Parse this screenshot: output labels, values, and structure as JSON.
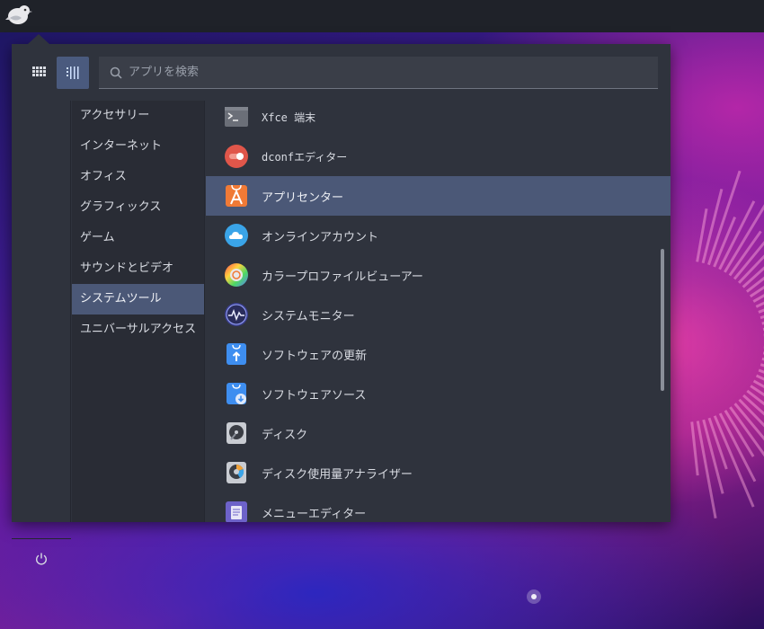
{
  "search": {
    "placeholder": "アプリを検索"
  },
  "view_toggle": {
    "grid_icon": "grid-icon",
    "list_icon": "list-icon"
  },
  "categories": [
    {
      "label": "アクセサリー"
    },
    {
      "label": "インターネット"
    },
    {
      "label": "オフィス"
    },
    {
      "label": "グラフィックス"
    },
    {
      "label": "ゲーム"
    },
    {
      "label": "サウンドとビデオ"
    },
    {
      "label": "システムツール"
    },
    {
      "label": "ユニバーサルアクセス"
    }
  ],
  "active_category": "システムツール",
  "apps": [
    {
      "label": "Xfce 端末",
      "icon": "terminal-icon"
    },
    {
      "label": "dconfエディター",
      "icon": "dconf-editor-icon"
    },
    {
      "label": "アプリセンター",
      "icon": "app-center-icon"
    },
    {
      "label": "オンラインアカウント",
      "icon": "cloud-icon"
    },
    {
      "label": "カラープロファイルビューアー",
      "icon": "color-profile-icon"
    },
    {
      "label": "システムモニター",
      "icon": "system-monitor-icon"
    },
    {
      "label": "ソフトウェアの更新",
      "icon": "software-update-icon"
    },
    {
      "label": "ソフトウェアソース",
      "icon": "software-sources-icon"
    },
    {
      "label": "ディスク",
      "icon": "disk-icon"
    },
    {
      "label": "ディスク使用量アナライザー",
      "icon": "disk-usage-icon"
    },
    {
      "label": "メニューエディター",
      "icon": "menu-editor-icon"
    }
  ],
  "active_app": "アプリセンター",
  "colors": {
    "menu_bg": "#2f333d",
    "selection": "#4b5877",
    "panel": "#1f2229"
  }
}
